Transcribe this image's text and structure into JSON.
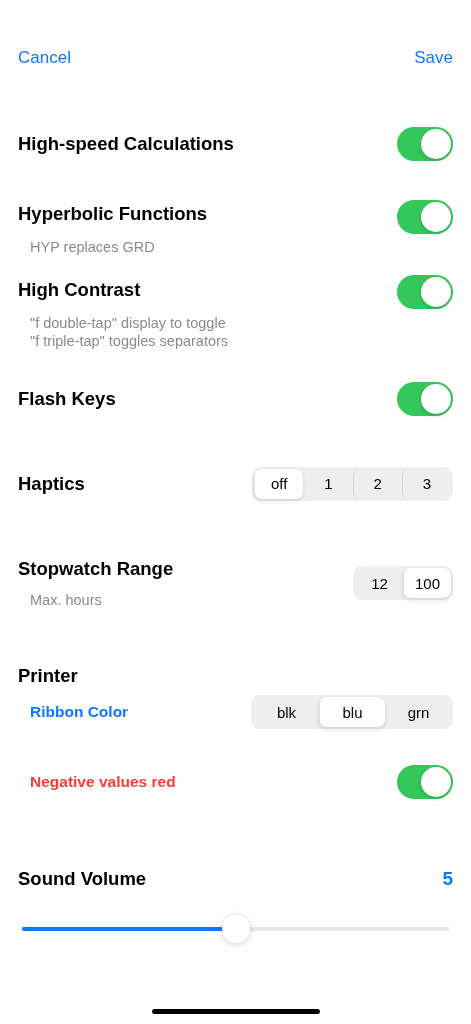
{
  "nav": {
    "cancel": "Cancel",
    "save": "Save"
  },
  "rows": [
    {
      "kind": "toggle",
      "title": "High-speed Calculations",
      "on": true
    },
    {
      "kind": "toggle",
      "title": "Hyperbolic Functions",
      "subtitle": [
        "HYP replaces GRD"
      ],
      "on": true
    },
    {
      "kind": "toggle",
      "title": "High Contrast",
      "subtitle": [
        "\"f double-tap\" display to toggle",
        "\"f triple-tap\" toggles separators"
      ],
      "on": true
    },
    {
      "kind": "toggle",
      "title": "Flash Keys",
      "on": true
    },
    {
      "kind": "segmented",
      "title": "Haptics",
      "options": [
        {
          "label": "off",
          "selected": true
        },
        {
          "label": "1",
          "selected": false
        },
        {
          "label": "2",
          "selected": false
        },
        {
          "label": "3",
          "selected": false
        }
      ]
    },
    {
      "kind": "segmented",
      "title": "Stopwatch Range",
      "subtitle": [
        "Max. hours"
      ],
      "options": [
        {
          "label": "12",
          "selected": false
        },
        {
          "label": "100",
          "selected": true
        }
      ]
    },
    {
      "kind": "group",
      "title": "Printer",
      "children": [
        {
          "kind": "segmented",
          "title": "Ribbon Color",
          "color": "#0a7aff",
          "options": [
            {
              "label": "blk",
              "selected": false
            },
            {
              "label": "blu",
              "selected": true
            },
            {
              "label": "grn",
              "selected": false
            }
          ]
        },
        {
          "kind": "toggle",
          "title": "Negative values red",
          "color": "#ff3b30",
          "on": true
        }
      ]
    },
    {
      "kind": "slider",
      "title": "Sound Volume",
      "value": "5",
      "level": 0.5
    }
  ]
}
